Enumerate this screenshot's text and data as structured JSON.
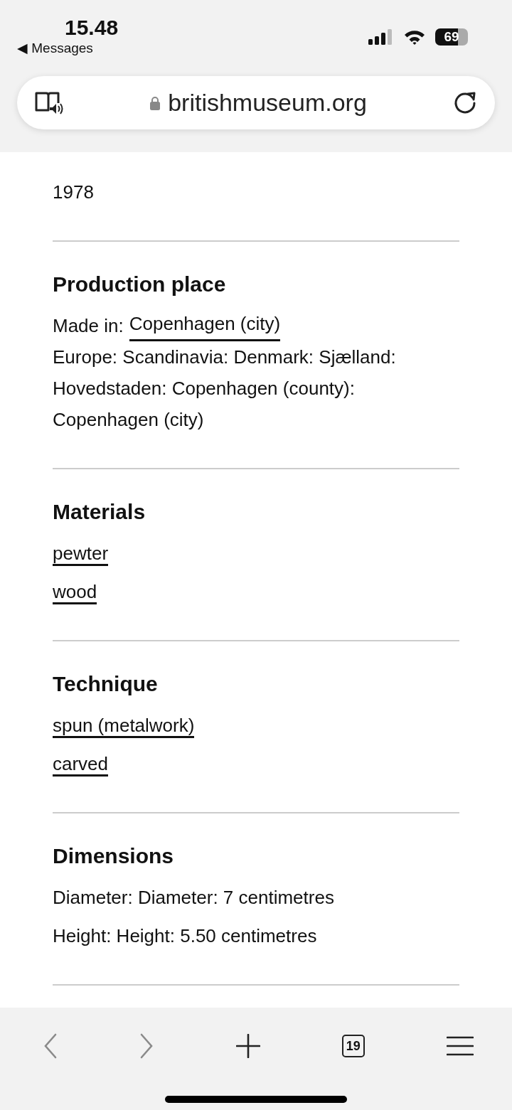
{
  "status_bar": {
    "time": "15.48",
    "back_label": "◀ Messages",
    "battery": "69"
  },
  "address_bar": {
    "url": "britishmuseum.org"
  },
  "sections": [
    {
      "items": [
        {
          "kind": "text",
          "text": "1978"
        }
      ]
    },
    {
      "heading": "Production place",
      "items": [
        {
          "kind": "labeled_link",
          "label": "Made in:",
          "text": "Copenhagen (city)"
        },
        {
          "kind": "paragraph",
          "text": "Europe: Scandinavia: Denmark: Sjælland: Hovedstaden: Copenhagen (county): Copenhagen (city)"
        }
      ]
    },
    {
      "heading": "Materials",
      "items": [
        {
          "kind": "link",
          "text": "pewter"
        },
        {
          "kind": "link",
          "text": "wood"
        }
      ]
    },
    {
      "heading": "Technique",
      "items": [
        {
          "kind": "link",
          "text": "spun (metalwork)"
        },
        {
          "kind": "link",
          "text": "carved"
        }
      ]
    },
    {
      "heading": "Dimensions",
      "items": [
        {
          "kind": "text",
          "text": "Diameter: Diameter: 7 centimetres"
        },
        {
          "kind": "text",
          "text": "Height: Height: 5.50 centimetres"
        }
      ]
    }
  ],
  "toolbar": [
    {
      "kind": "back",
      "disabled": true
    },
    {
      "kind": "forward",
      "disabled": true
    },
    {
      "kind": "new_tab",
      "disabled": false
    },
    {
      "kind": "tabs",
      "count": "19",
      "disabled": false
    },
    {
      "kind": "menu",
      "disabled": false
    }
  ]
}
